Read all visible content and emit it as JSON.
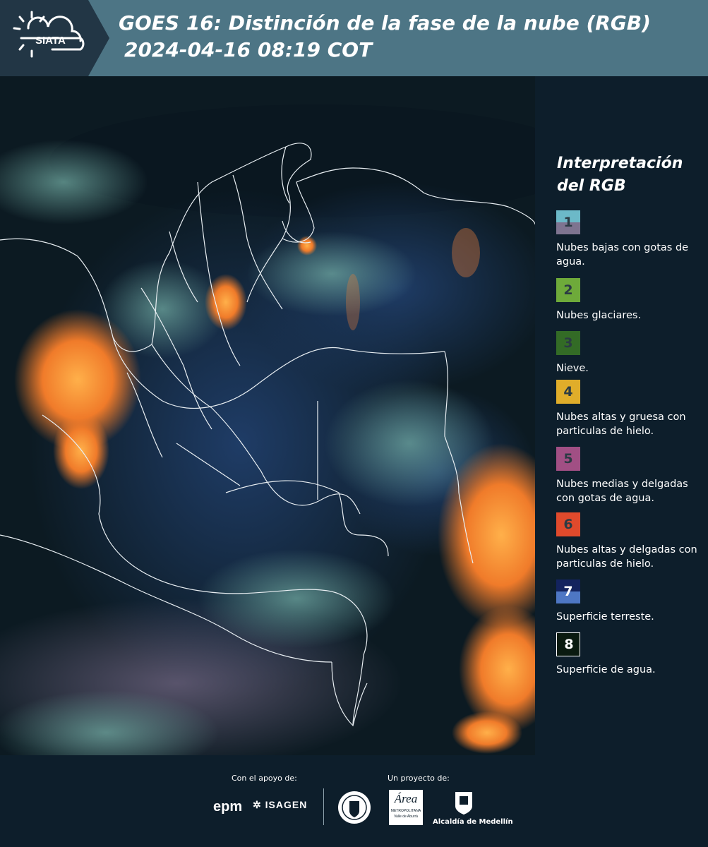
{
  "header": {
    "logo_text": "SIATA",
    "title_line1": "GOES 16: Distinción de la fase de la nube (RGB)",
    "title_line2": "2024-04-16 08:19 COT"
  },
  "legend": {
    "title_line1": "Interpretación",
    "title_line2": "del RGB",
    "items": [
      {
        "number": "1",
        "label": "Nubes bajas con gotas de agua.",
        "color_top": "#6cb9c8",
        "color_bottom": "#7e7490"
      },
      {
        "number": "2",
        "label": "Nubes glaciares.",
        "color": "#6eaa3a"
      },
      {
        "number": "3",
        "label": "Nieve.",
        "color": "#336b26"
      },
      {
        "number": "4",
        "label": "Nubes altas y gruesa con particulas de hielo.",
        "color": "#e0ad2a"
      },
      {
        "number": "5",
        "label": "Nubes medias y delgadas con gotas de agua.",
        "color": "#a14f84"
      },
      {
        "number": "6",
        "label": "Nubes altas y delgadas con particulas de hielo.",
        "color": "#e04a2c"
      },
      {
        "number": "7",
        "label": "Superficie terreste.",
        "color_top": "#13235e",
        "color_bottom": "#4e77c4"
      },
      {
        "number": "8",
        "label": "Superficie de agua.",
        "color": "#0a1a10"
      }
    ]
  },
  "footer": {
    "support_label": "Con el apoyo de:",
    "project_label": "Un proyecto de:",
    "sponsor_epm": "epm",
    "sponsor_isagen": "ISAGEN",
    "partner_area": "Área",
    "partner_area_sub1": "METROPOLITANA",
    "partner_area_sub2": "Valle de Aburrá",
    "partner_alcaldia": "Alcaldía de Medellín"
  }
}
